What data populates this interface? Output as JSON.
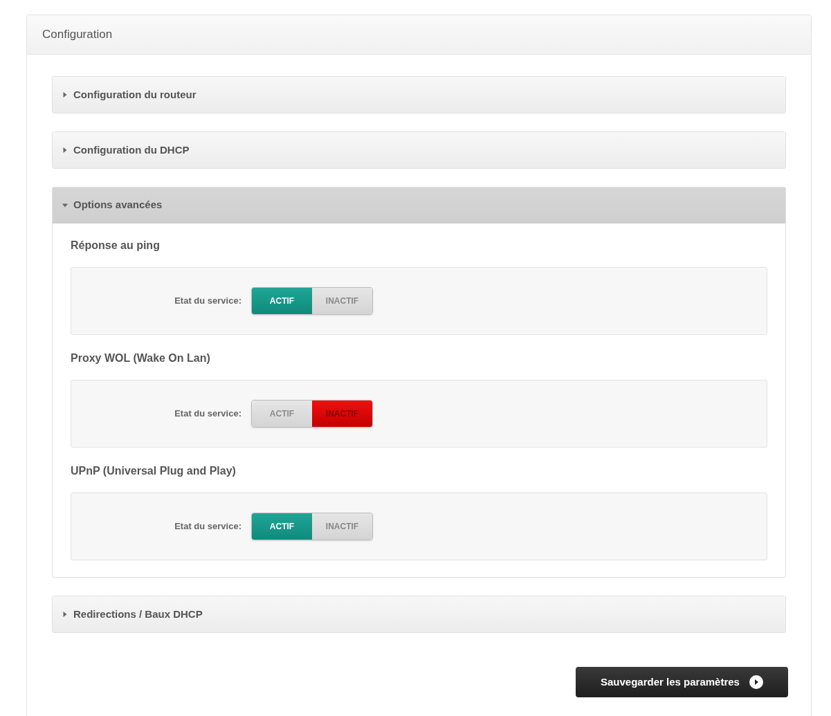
{
  "panel": {
    "title": "Configuration"
  },
  "accordions": [
    {
      "title": "Configuration du routeur",
      "expanded": false
    },
    {
      "title": "Configuration du DHCP",
      "expanded": false
    },
    {
      "title": "Options avancées",
      "expanded": true,
      "sections": [
        {
          "title": "Réponse au ping",
          "label": "Etat du service:",
          "options": [
            {
              "label": "ACTIF",
              "kind": "on",
              "selected": true
            },
            {
              "label": "INACTIF",
              "kind": "off",
              "selected": false
            }
          ]
        },
        {
          "title": "Proxy WOL (Wake On Lan)",
          "label": "Etat du service:",
          "options": [
            {
              "label": "ACTIF",
              "kind": "on",
              "selected": false
            },
            {
              "label": "INACTIF",
              "kind": "off",
              "selected": true
            }
          ]
        },
        {
          "title": "UPnP (Universal Plug and Play)",
          "label": "Etat du service:",
          "options": [
            {
              "label": "ACTIF",
              "kind": "on",
              "selected": true
            },
            {
              "label": "INACTIF",
              "kind": "off",
              "selected": false
            }
          ]
        }
      ]
    },
    {
      "title": "Redirections / Baux DHCP",
      "expanded": false
    }
  ],
  "save_button": {
    "label": "Sauvegarder les paramètres"
  }
}
